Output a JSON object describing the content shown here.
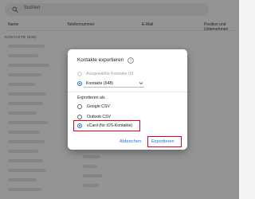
{
  "search": {
    "placeholder": "Suchen"
  },
  "table": {
    "headers": {
      "name": "Name",
      "phone": "Telefonnummer",
      "email": "E-Mail",
      "position": "Position und Unternehmen"
    },
    "section_label": "KONTAKTE (648)"
  },
  "dialog": {
    "title": "Kontakte exportieren",
    "source_options": [
      {
        "label": "Ausgewählte Kontakte (0)",
        "checked": false,
        "disabled": true
      },
      {
        "label": "Kontakte (648)",
        "checked": true,
        "disabled": false
      }
    ],
    "export_section_title": "Exportieren als",
    "format_options": [
      {
        "label": "Google CSV",
        "checked": false
      },
      {
        "label": "Outlook CSV",
        "checked": false
      },
      {
        "label": "vCard (für iOS-Kontakte)",
        "checked": true
      }
    ],
    "cancel_label": "Abbrechen",
    "export_label": "Exportieren"
  },
  "colors": {
    "accent": "#1a73e8",
    "highlight": "#e2001a"
  },
  "icons": {
    "search": "search-icon",
    "help": "help-circle-icon",
    "dropdown": "chevron-down-icon"
  }
}
